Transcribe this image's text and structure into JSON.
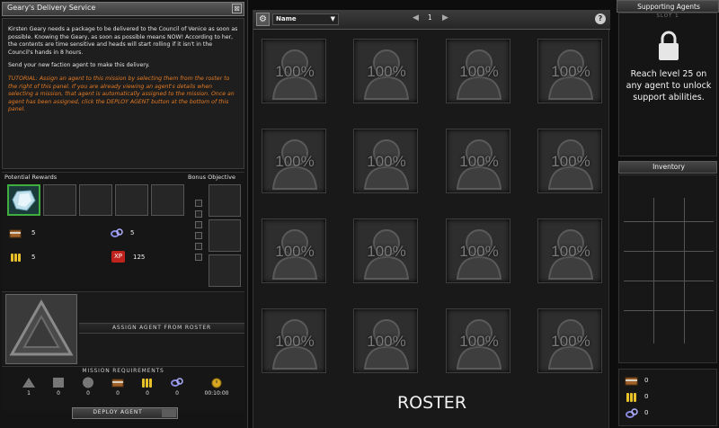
{
  "mission": {
    "title": "Geary's Delivery Service",
    "close_glyph": "⊠",
    "description": "Kirsten Geary needs a package to be delivered to the Council of Venice as soon as possible. Knowing the Geary, as soon as possible means NOW! According to her, the contents are time sensitive and heads will start rolling if it isn't in the Council's hands in 8 hours.",
    "instruction": "Send your new faction agent to make this delivery.",
    "tutorial": "TUTORIAL: Assign an agent to this mission by selecting them from the roster to the right of this panel. If you are already viewing an agent's details when selecting a mission, that agent is automatically assigned to the mission. Once an agent has been assigned, click the DEPLOY AGENT button at the bottom of this panel."
  },
  "rewards": {
    "label": "Potential Rewards",
    "bonus_label": "Bonus Objective",
    "items": [
      {
        "icon": "treasure-chest-icon",
        "value": "5"
      },
      {
        "icon": "chain-link-icon",
        "value": "5"
      },
      {
        "icon": "ammo-bullets-icon",
        "value": "5"
      },
      {
        "icon": "xp-icon",
        "icon_text": "XP",
        "value": "125"
      }
    ]
  },
  "agent": {
    "assign_label": "ASSIGN AGENT FROM ROSTER"
  },
  "requirements": {
    "label": "MISSION REQUIREMENTS",
    "items": [
      {
        "icon": "triangle-icon",
        "value": "1"
      },
      {
        "icon": "square-icon",
        "value": "0"
      },
      {
        "icon": "circle-icon",
        "value": "0"
      },
      {
        "icon": "treasure-chest-icon",
        "value": "0"
      },
      {
        "icon": "ammo-bullets-icon",
        "value": "0"
      },
      {
        "icon": "chain-link-icon",
        "value": "0"
      },
      {
        "icon": "timer-icon",
        "value": "00:10:00"
      }
    ]
  },
  "deploy_label": "DEPLOY AGENT",
  "roster": {
    "sort_value": "Name",
    "page": "1",
    "title": "ROSTER",
    "slots": [
      "100%",
      "100%",
      "100%",
      "100%",
      "100%",
      "100%",
      "100%",
      "100%",
      "100%",
      "100%",
      "100%",
      "100%",
      "100%",
      "100%",
      "100%",
      "100%"
    ]
  },
  "support": {
    "title": "Supporting Agents",
    "slot_label": "SLOT 1",
    "message": "Reach level 25 on any agent to unlock support abilities."
  },
  "inventory": {
    "title": "Inventory"
  },
  "currency": [
    {
      "icon": "treasure-chest-icon",
      "value": "0"
    },
    {
      "icon": "ammo-bullets-icon",
      "value": "0"
    },
    {
      "icon": "chain-link-icon",
      "value": "0"
    }
  ],
  "colors": {
    "tutorial": "#e27a24",
    "selected_reward_border": "#3fae3f",
    "xp_badge": "#c0221d"
  }
}
